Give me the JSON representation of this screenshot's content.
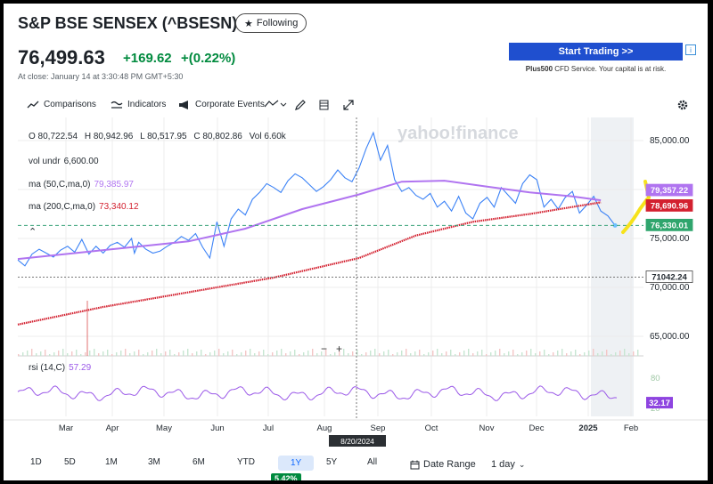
{
  "header": {
    "title": "S&P BSE SENSEX (^BSESN)",
    "follow_label": "Following",
    "price": "76,499.63",
    "change": "+169.62",
    "change_pct": "+(0.22%)",
    "close_note": "At close: January 14 at 3:30:48 PM GMT+5:30"
  },
  "ad": {
    "button": "Start Trading >>",
    "brand": "Plus500",
    "note": "CFD Service. Your capital is at risk.",
    "info": "i"
  },
  "toolbar": {
    "comparisons": "Comparisons",
    "indicators": "Indicators",
    "corporate_events": "Corporate Events"
  },
  "ohlc": {
    "o": "O 80,722.54",
    "h": "H 80,942.96",
    "l": "L 80,517.95",
    "c": "C 80,802.86",
    "vol": "Vol 6.60k"
  },
  "legend": {
    "vol_label": "vol undr",
    "vol_value": "6,600.00",
    "ma50_label": "ma (50,C,ma,0)",
    "ma50_value": "79,385.97",
    "ma200_label": "ma (200,C,ma,0)",
    "ma200_value": "73,340.12",
    "rsi_label": "rsi (14,C)",
    "rsi_value": "57.29"
  },
  "colors": {
    "price": "#3b82f6",
    "ma50": "#b074f0",
    "ma200": "#d3202f",
    "rsi": "#9b59e8",
    "up": "#008a3e"
  },
  "crosshair_date": "8/20/2024",
  "watermark": "yahoo!finance",
  "zoom": {
    "minus": "−",
    "plus": "+"
  },
  "ranges": [
    "1D",
    "5D",
    "1M",
    "3M",
    "6M",
    "YTD",
    "1Y",
    "5Y",
    "All"
  ],
  "active_range": "1Y",
  "range_pct": "5.42%",
  "date_range_label": "Date Range",
  "interval_label": "1 day",
  "chart_data": {
    "type": "line",
    "x_tick_labels": [
      "Mar",
      "Apr",
      "May",
      "Jun",
      "Jul",
      "Aug",
      "Sep",
      "Oct",
      "Nov",
      "Dec",
      "2025",
      "Feb"
    ],
    "y_tick_labels": [
      "85,000.00",
      "80,000.00",
      "75,000.00",
      "70,000.00",
      "65,000.00"
    ],
    "ylim": [
      63000,
      87000
    ],
    "series": [
      {
        "name": "close",
        "x": [
          0,
          5,
          10,
          15,
          20,
          25,
          30,
          35,
          40,
          45,
          50,
          55,
          60,
          65,
          70,
          75,
          80,
          82,
          85,
          90,
          95,
          100,
          105,
          110,
          115,
          120,
          125,
          130,
          135,
          140,
          145,
          150,
          155,
          160,
          165,
          170,
          175,
          180,
          185,
          190,
          195,
          200,
          205,
          210,
          215,
          220,
          225,
          230,
          235,
          240,
          245,
          250,
          255,
          260
        ],
        "values": [
          72800,
          72200,
          73400,
          73900,
          73500,
          73100,
          73800,
          74200,
          73600,
          74900,
          73400,
          74200,
          73500,
          74300,
          74600,
          74100,
          75000,
          73500,
          74600,
          73900,
          73500,
          73700,
          74200,
          74600,
          75200,
          74800,
          75500,
          74100,
          73000,
          76700,
          74200,
          77000,
          78000,
          77400,
          79000,
          79700,
          80600,
          80200,
          79700,
          80900,
          81600,
          81200,
          80500,
          79800,
          80300,
          81000,
          82000,
          81200,
          80800,
          82200,
          84200,
          85800,
          83000,
          84500
        ],
        "values_tail_x": [
          265,
          270,
          275,
          280,
          285,
          290,
          295,
          300,
          305,
          310,
          315,
          320,
          325,
          330,
          335,
          340,
          345,
          350,
          355,
          360,
          365,
          370,
          375,
          380,
          385,
          390,
          395,
          400,
          405,
          410,
          415,
          420
        ],
        "values_tail": [
          81000,
          79800,
          80200,
          79400,
          79000,
          79600,
          78200,
          78800,
          77800,
          79300,
          77600,
          77000,
          78600,
          79200,
          78200,
          80200,
          79400,
          78600,
          80600,
          81500,
          81000,
          78200,
          79000,
          78000,
          79200,
          79800,
          77600,
          78400,
          79300,
          77800,
          77300,
          76330
        ]
      },
      {
        "name": "ma (50,C,ma,0)",
        "values_note": "50-day moving average"
      },
      {
        "name": "ma (200,C,ma,0)",
        "values_note": "200-day moving average"
      }
    ],
    "annotations": [
      {
        "label": "79,357.22"
      },
      {
        "label": "78,690.96"
      },
      {
        "label": "76,330.01"
      },
      {
        "label": "71042.24"
      }
    ],
    "rsi": {
      "y_tick_labels": [
        "80",
        "20"
      ],
      "last_value": "32.17"
    }
  }
}
